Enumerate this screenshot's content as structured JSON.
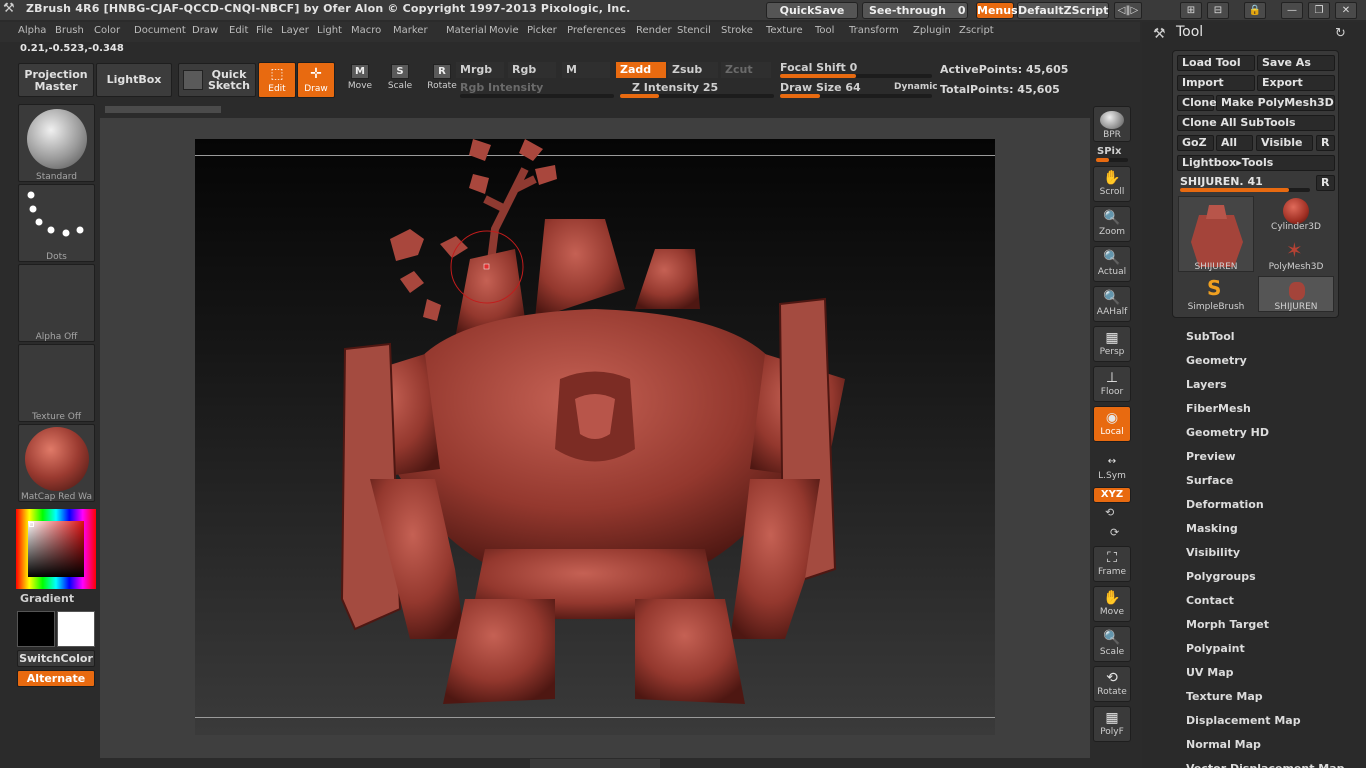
{
  "titlebar": {
    "app_title": "ZBrush 4R6 [HNBG-CJAF-QCCD-CNQI-NBCF] by Ofer Alon © Copyright 1997-2013 Pixologic, Inc.",
    "quicksave": "QuickSave",
    "see_through": "See-through",
    "see_through_value": "0",
    "menus": "Menus",
    "default_zscript": "DefaultZScript"
  },
  "menubar": {
    "items": [
      "Alpha",
      "Brush",
      "Color",
      "Document",
      "Draw",
      "Edit",
      "File",
      "Layer",
      "Light",
      "Macro",
      "Marker",
      "Material",
      "Movie",
      "Picker",
      "Preferences",
      "Render",
      "Stencil",
      "Stroke",
      "Texture",
      "Tool",
      "Transform",
      "Zplugin",
      "Zscript"
    ]
  },
  "coords": "0.21,-0.523,-0.348",
  "shelf": {
    "projection_master": "Projection Master",
    "lightbox": "LightBox",
    "quick_sketch": "Quick Sketch",
    "edit": "Edit",
    "draw": "Draw",
    "move": "Move",
    "scale": "Scale",
    "rotate": "Rotate",
    "move_glyph": "M",
    "scale_glyph": "S",
    "rotate_glyph": "R",
    "mrgb": "Mrgb",
    "rgb": "Rgb",
    "m": "M",
    "zadd": "Zadd",
    "zsub": "Zsub",
    "zcut": "Zcut",
    "rgb_intensity": "Rgb Intensity",
    "z_intensity_label": "Z Intensity",
    "z_intensity_value": "25",
    "focal_shift_label": "Focal Shift",
    "focal_shift_value": "0",
    "draw_size_label": "Draw Size",
    "draw_size_value": "64",
    "dynamic": "Dynamic",
    "active_points": "ActivePoints: 45,605",
    "total_points": "TotalPoints: 45,605"
  },
  "left_shelf": {
    "brush": "Standard",
    "stroke": "Dots",
    "alpha": "Alpha Off",
    "texture": "Texture Off",
    "material": "MatCap Red Wa",
    "gradient": "Gradient",
    "switch_color": "SwitchColor",
    "alternate": "Alternate"
  },
  "right_toolbar": {
    "bpr": "BPR",
    "spix": "SPix",
    "scroll": "Scroll",
    "zoom": "Zoom",
    "actual": "Actual",
    "aahalf": "AAHalf",
    "persp": "Persp",
    "floor": "Floor",
    "local": "Local",
    "lsym": "L.Sym",
    "xyz": "XYZ",
    "frame": "Frame",
    "move": "Move",
    "scale": "Scale",
    "rotate": "Rotate",
    "polyf": "PolyF"
  },
  "tool_panel": {
    "title": "Tool",
    "load_tool": "Load Tool",
    "save_as": "Save As",
    "import": "Import",
    "export": "Export",
    "clone": "Clone",
    "make_polymesh": "Make PolyMesh3D",
    "clone_all": "Clone All SubTools",
    "goz": "GoZ",
    "all": "All",
    "visible": "Visible",
    "r": "R",
    "lightbox_tools": "Lightbox▸Tools",
    "current_tool": "SHIJUREN. 41",
    "thumbs": [
      "SHIJUREN",
      "Cylinder3D",
      "PolyMesh3D",
      "SimpleBrush",
      "SHIJUREN"
    ],
    "sections": [
      "SubTool",
      "Geometry",
      "Layers",
      "FiberMesh",
      "Geometry HD",
      "Preview",
      "Surface",
      "Deformation",
      "Masking",
      "Visibility",
      "Polygroups",
      "Contact",
      "Morph Target",
      "Polypaint",
      "UV Map",
      "Texture Map",
      "Displacement Map",
      "Normal Map",
      "Vector Displacement Map"
    ]
  },
  "colors": {
    "accent": "#e86a10",
    "model": "#9a3a30"
  }
}
